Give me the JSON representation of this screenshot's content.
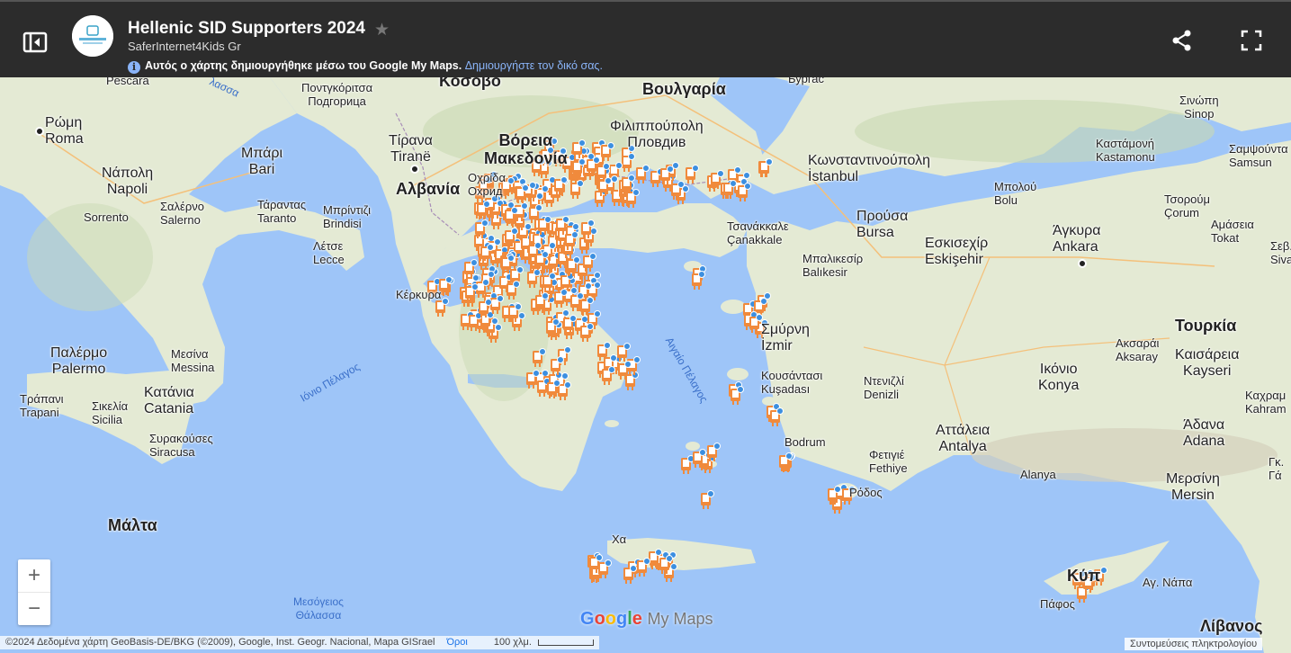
{
  "header": {
    "title": "Hellenic SID Supporters 2024",
    "author": "SaferInternet4Kids Gr",
    "notice_text": "Αυτός ο χάρτης δημιουργήθηκε μέσω του Google My Maps.",
    "notice_link": "Δημιουργήστε τον δικό σας."
  },
  "icons": {
    "sidebar": "sidebar-toggle-icon",
    "star": "star-icon",
    "share": "share-icon",
    "fullscreen": "fullscreen-icon",
    "info": "info-icon",
    "marker": "robot-marker-icon"
  },
  "map": {
    "colors": {
      "sea": "#9ec5f8",
      "land": "#e8eddc",
      "marker": "#f08a3c",
      "marker_head": "#3c8fe0"
    },
    "labels": {
      "pescara": "Pescara",
      "kosovo": "Κόσοβο",
      "podgorica": "Ποντγκόριτσα\nПодгорица",
      "bulgaria": "Βουλγαρία",
      "byrgas": "Бургас",
      "sinop": "Σινώπη\nSinop",
      "roma": "Ρώμη\nRoma",
      "tirana": "Τίρανα\nTiranë",
      "n_macedonia": "Βόρεια\nΜακεδονία",
      "ohrid": "Οχρίδα\nОхрид",
      "plovdiv": "Φιλιππούπολη\nПловдив",
      "kastamonu": "Καστάμονή\nKastamonu",
      "samsun": "Σαμψούντα\nSamsun",
      "bari": "Μπάρι\nBari",
      "napoli": "Νάπολη\nNapoli",
      "istanbul": "Κωνσταντινούπολη\nİstanbul",
      "albania": "Αλβανία",
      "bolu": "Μπολού\nBolu",
      "corum": "Τσορούμ\nÇorum",
      "taranto": "Τάραντας\nTaranto",
      "brindisi": "Μπρίντιζι\nBrindisi",
      "salerno": "Σαλέρνο\nSalerno",
      "sorrento": "Sorrento",
      "amasya": "Αμάσεια\nTokat",
      "canakkale": "Τσανάκκαλε\nÇanakkale",
      "bursa": "Προύσα\nBursa",
      "eskisehir": "Εσκισεχίρ\nEskişehir",
      "ankara": "Άγκυρα\nAnkara",
      "lecce": "Λέτσε\nLecce",
      "balikesir": "Μπαλικεσίρ\nBalıkesir",
      "sivas": "Σεβ.\nSiva",
      "kerkyra": "Κέρκυρα",
      "izmir": "Σμύρνη\nİzmir",
      "turkey": "Τουρκία",
      "palermo": "Παλέρμο\nPalermo",
      "messina": "Μεσίνα\nMessina",
      "aksaray": "Ακσαράι\nAksaray",
      "kayseri": "Καισάρεια\nKayseri",
      "ionian": "Ιόνιο Πέλαγος",
      "aegean": "Αιγαίο Πέλαγος",
      "kusadasi": "Κουσάντασι\nKuşadası",
      "denizli": "Ντενιζλί\nDenizli",
      "konya": "Ικόνιο\nKonya",
      "trapani": "Τράπανι\nTrapani",
      "catania": "Κατάνια\nCatania",
      "sicilia": "Σικελία\nSicilia",
      "kahramanmaras": "Καχραμ\nKahram",
      "antalya": "Αττάλεια\nAntalya",
      "adana": "Άδανα\nAdana",
      "siracusa": "Συρακούσες\nSiracusa",
      "bodrum": "Bodrum",
      "fethiye": "Φετιγιέ\nFethiye",
      "alanya": "Alanya",
      "mersin": "Μερσίνη\nMersin",
      "rhodes": "Ρόδος",
      "malta": "Μάλτα",
      "crete": "Χα",
      "cyprus": "Κύπ",
      "ayia_napa": "Αγ. Νάπα",
      "paphos": "Πάφος",
      "lebanon": "Λίβανος",
      "gaziantep": "Γκ.\nΓά",
      "med_sea": "Μεσόγειος\nΘάλασσα",
      "adriatic": "λασσα"
    }
  },
  "controls": {
    "zoom_in": "+",
    "zoom_out": "−",
    "shortcuts": "Συντομεύσεις πληκτρολογίου"
  },
  "footer": {
    "attribution": "©2024 Δεδομένα χάρτη GeoBasis-DE/BKG (©2009), Google, Inst. Geogr. Nacional, Mapa GISrael",
    "terms": "Όροι",
    "scale": "100 χλμ."
  },
  "branding": {
    "google": "Google",
    "mymaps": "My Maps"
  }
}
